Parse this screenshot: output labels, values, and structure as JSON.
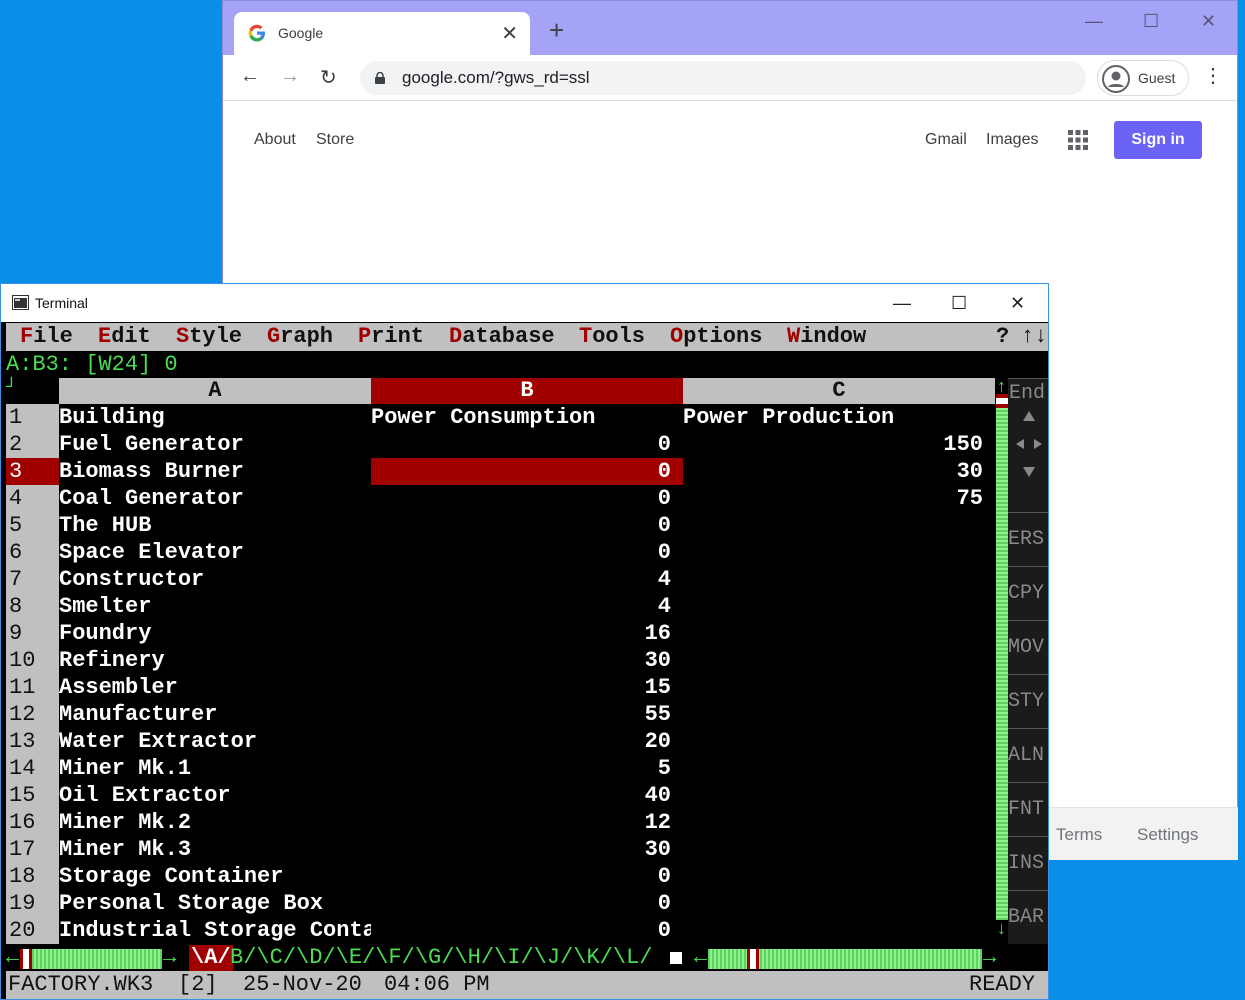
{
  "browser": {
    "tab_title": "Google",
    "tab_close": "✕",
    "new_tab": "+",
    "url": "google.com/?gws_rd=ssl",
    "profile_label": "Guest",
    "links_left": [
      "About",
      "Store"
    ],
    "links_right": [
      "Gmail",
      "Images"
    ],
    "sign_in": "Sign in",
    "footer_links": [
      "Terms",
      "Settings"
    ],
    "controls": {
      "minimize": "—",
      "maximize": "☐",
      "close": "✕"
    },
    "nav": {
      "back": "←",
      "forward": "→",
      "reload": "↻",
      "menu": "⋮"
    }
  },
  "terminal": {
    "title": "Terminal",
    "controls": {
      "minimize": "—",
      "maximize": "☐",
      "close": "✕"
    },
    "menu": [
      {
        "accel": "F",
        "rest": "ile"
      },
      {
        "accel": "E",
        "rest": "dit"
      },
      {
        "accel": "S",
        "rest": "tyle"
      },
      {
        "accel": "G",
        "rest": "raph"
      },
      {
        "accel": "P",
        "rest": "rint"
      },
      {
        "accel": "D",
        "rest": "atabase"
      },
      {
        "accel": "T",
        "rest": "ools"
      },
      {
        "accel": "O",
        "rest": "ptions"
      },
      {
        "accel": "W",
        "rest": "indow"
      }
    ],
    "menu_help": "?",
    "menu_arrows": "↑↓",
    "cell_line": "A:B3: [W24] 0",
    "corner": "┘",
    "columns": [
      "A",
      "B",
      "C"
    ],
    "selected_column": "B",
    "selected_row": 3,
    "rows": [
      {
        "n": "1",
        "a": "Building",
        "b": "Power Consumption",
        "c": "Power Production"
      },
      {
        "n": "2",
        "a": "Fuel Generator",
        "b": "0",
        "c": "150"
      },
      {
        "n": "3",
        "a": "Biomass Burner",
        "b": "0",
        "c": "30"
      },
      {
        "n": "4",
        "a": "Coal Generator",
        "b": "0",
        "c": "75"
      },
      {
        "n": "5",
        "a": "The HUB",
        "b": "0",
        "c": ""
      },
      {
        "n": "6",
        "a": "Space Elevator",
        "b": "0",
        "c": ""
      },
      {
        "n": "7",
        "a": "Constructor",
        "b": "4",
        "c": ""
      },
      {
        "n": "8",
        "a": "Smelter",
        "b": "4",
        "c": ""
      },
      {
        "n": "9",
        "a": "Foundry",
        "b": "16",
        "c": ""
      },
      {
        "n": "10",
        "a": "Refinery",
        "b": "30",
        "c": ""
      },
      {
        "n": "11",
        "a": "Assembler",
        "b": "15",
        "c": ""
      },
      {
        "n": "12",
        "a": "Manufacturer",
        "b": "55",
        "c": ""
      },
      {
        "n": "13",
        "a": "Water Extractor",
        "b": "20",
        "c": ""
      },
      {
        "n": "14",
        "a": "Miner Mk.1",
        "b": "5",
        "c": ""
      },
      {
        "n": "15",
        "a": "Oil Extractor",
        "b": "40",
        "c": ""
      },
      {
        "n": "16",
        "a": "Miner Mk.2",
        "b": "12",
        "c": ""
      },
      {
        "n": "17",
        "a": "Miner Mk.3",
        "b": "30",
        "c": ""
      },
      {
        "n": "18",
        "a": "Storage Container",
        "b": "0",
        "c": ""
      },
      {
        "n": "19",
        "a": "Personal Storage Box",
        "b": "0",
        "c": ""
      },
      {
        "n": "20",
        "a": "Industrial Storage Conta",
        "b": "0",
        "c": ""
      }
    ],
    "icon_panel": {
      "end": "End",
      "buttons": [
        "ERS",
        "CPY",
        "MOV",
        "STY",
        "ALN",
        "FNT",
        "INS",
        "BAR"
      ]
    },
    "scroll": {
      "up": "↑",
      "down": "↓",
      "left": "←",
      "right": "→"
    },
    "sheet_active": "\\A/",
    "sheet_tabs": "B/\\C/\\D/\\E/\\F/\\G/\\H/\\I/\\J/\\K/\\L/",
    "status": {
      "file": "FACTORY.WK3",
      "window": "[2]",
      "date": "25-Nov-20",
      "time": "04:06 PM",
      "mode": "READY"
    }
  }
}
